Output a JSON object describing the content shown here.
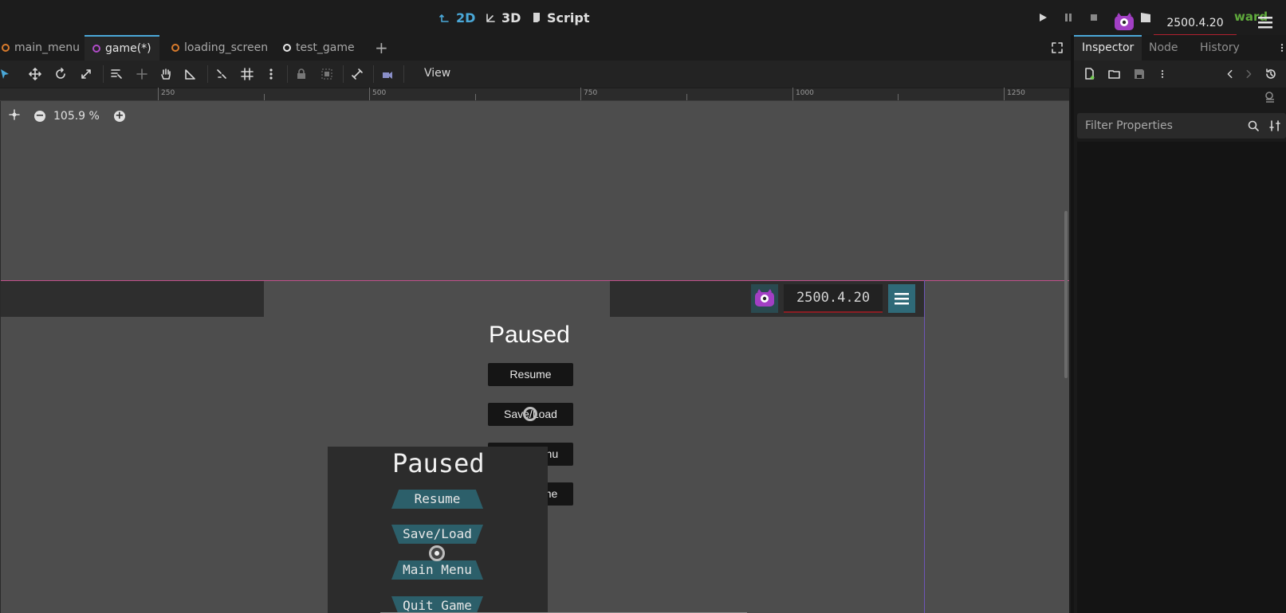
{
  "topbar": {
    "modes": [
      {
        "label": "2D",
        "icon": "2d-icon",
        "active": true
      },
      {
        "label": "3D",
        "icon": "3d-icon",
        "active": false
      },
      {
        "label": "Script",
        "icon": "script-icon",
        "active": false
      }
    ],
    "version": "2500.4.20",
    "user": "ward"
  },
  "scene_tabs": [
    {
      "label": "main_menu",
      "dot_color": "#d97b2c",
      "active": false
    },
    {
      "label": "game(*)",
      "dot_color": "#b04cc8",
      "active": true
    },
    {
      "label": "loading_screen",
      "dot_color": "#d97b2c",
      "active": false
    },
    {
      "label": "test_game",
      "dot_color": "#e8e8e8",
      "active": false
    }
  ],
  "toolbar": {
    "view_label": "View"
  },
  "ruler": {
    "labels": [
      "250",
      "500",
      "750",
      "1000",
      "1250"
    ]
  },
  "viewport": {
    "zoom": "105.9 %",
    "hud_date": "2500.4.20",
    "paused_title": "Paused",
    "pause_buttons": [
      "Resume",
      "Save/Load",
      "Main Menu",
      "Quit Game"
    ],
    "themed_title": "Paused",
    "themed_buttons": [
      "Resume",
      "Save/Load",
      "Main Menu",
      "Quit Game"
    ]
  },
  "dock": {
    "tabs": [
      {
        "label": "Inspector",
        "active": true
      },
      {
        "label": "Node",
        "active": false
      },
      {
        "label": "History",
        "active": false
      }
    ],
    "filter_placeholder": "Filter Properties"
  },
  "colors": {
    "accent": "#4aa8d8",
    "viewport_bg": "#4d4d4d",
    "themed_button": "#2c5f6a",
    "godot_purple": "#a23fc4"
  }
}
